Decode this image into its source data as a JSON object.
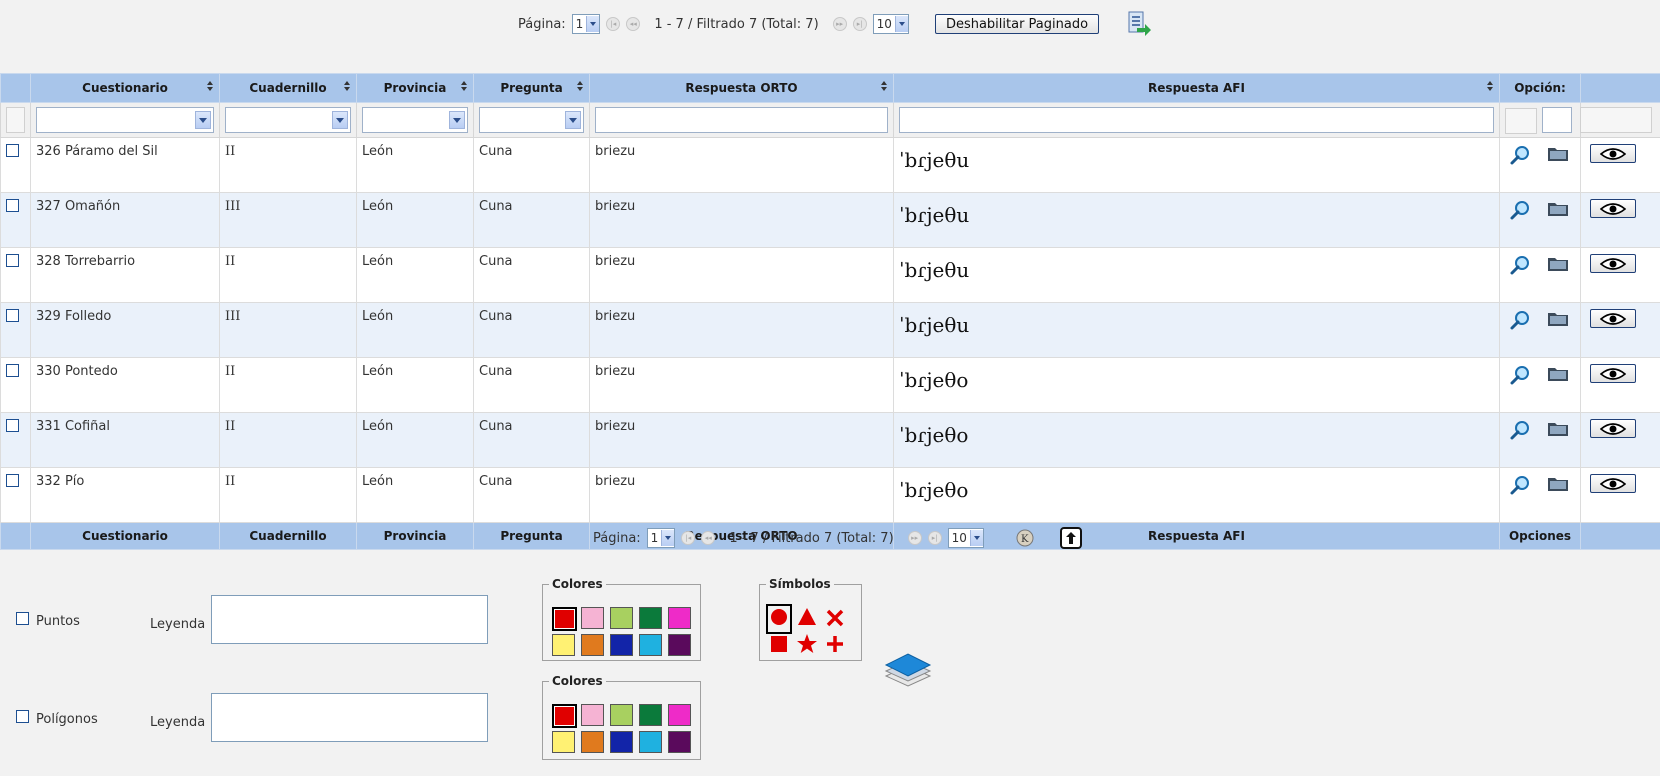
{
  "pager_top": {
    "pagina_label": "Página:",
    "page": "1",
    "range": "1 - 7 / Filtrado 7 (Total: 7)",
    "page_size": "10",
    "disable_button": "Deshabilitar Paginado"
  },
  "pager_bottom": {
    "pagina_label": "Página:",
    "page": "1",
    "range": "1 - 7 / Filtrado 7 (Total: 7)",
    "page_size": "10"
  },
  "columns": [
    "Cuestionario",
    "Cuadernillo",
    "Provincia",
    "Pregunta",
    "Respuesta ORTO",
    "Respuesta AFI",
    "Opción:"
  ],
  "footer_columns": [
    "Cuestionario",
    "Cuadernillo",
    "Provincia",
    "Pregunta",
    "Respuesta ORTO",
    "Respuesta AFI",
    "Opciones"
  ],
  "rows": [
    {
      "cuestionario": "326 Páramo del Sil",
      "cuadernillo": "II",
      "provincia": "León",
      "pregunta": "Cuna",
      "orto": "briezu",
      "afi": "ˈbɾjeθu"
    },
    {
      "cuestionario": "327 Omañón",
      "cuadernillo": "III",
      "provincia": "León",
      "pregunta": "Cuna",
      "orto": "briezu",
      "afi": "ˈbɾjeθu"
    },
    {
      "cuestionario": "328 Torrebarrio",
      "cuadernillo": "II",
      "provincia": "León",
      "pregunta": "Cuna",
      "orto": "briezu",
      "afi": "ˈbɾjeθu"
    },
    {
      "cuestionario": "329 Folledo",
      "cuadernillo": "III",
      "provincia": "León",
      "pregunta": "Cuna",
      "orto": "briezu",
      "afi": "ˈbɾjeθu"
    },
    {
      "cuestionario": "330 Pontedo",
      "cuadernillo": "II",
      "provincia": "León",
      "pregunta": "Cuna",
      "orto": "briezu",
      "afi": "ˈbɾjeθo"
    },
    {
      "cuestionario": "331 Cofiñal",
      "cuadernillo": "II",
      "provincia": "León",
      "pregunta": "Cuna",
      "orto": "briezu",
      "afi": "ˈbɾjeθo"
    },
    {
      "cuestionario": "332 Pío",
      "cuadernillo": "II",
      "provincia": "León",
      "pregunta": "Cuna",
      "orto": "briezu",
      "afi": "ˈbɾjeθo"
    }
  ],
  "map_options": {
    "puntos_label": "Puntos",
    "poligonos_label": "Polígonos",
    "leyenda_label": "Leyenda",
    "colores_label": "Colores",
    "simbolos_label": "Símbolos",
    "colors": [
      "#e00000",
      "#f5b3d3",
      "#a8d060",
      "#0b7a3b",
      "#ee2bc8",
      "#fff173",
      "#e07a1e",
      "#1224a8",
      "#1fb1e0",
      "#5a0a5c"
    ],
    "symbols": [
      "circle",
      "triangle",
      "x",
      "square",
      "star",
      "plus"
    ],
    "symbol_color": "#e00000"
  }
}
